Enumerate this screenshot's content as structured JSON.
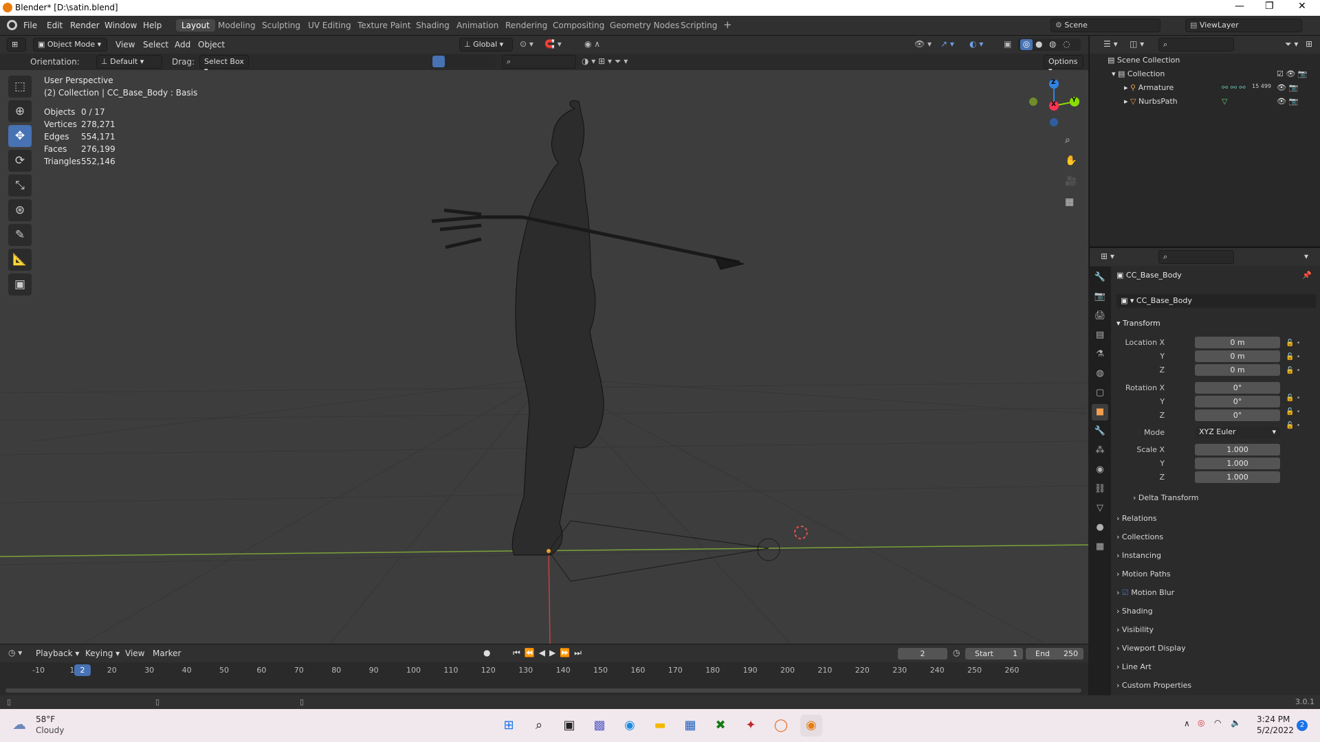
{
  "window": {
    "title": "Blender* [D:\\satin.blend]",
    "controls": [
      "—",
      "❐",
      "✕"
    ]
  },
  "menus": [
    "File",
    "Edit",
    "Render",
    "Window",
    "Help"
  ],
  "workspaces": [
    "Layout",
    "Modeling",
    "Sculpting",
    "UV Editing",
    "Texture Paint",
    "Shading",
    "Animation",
    "Rendering",
    "Compositing",
    "Geometry Nodes",
    "Scripting"
  ],
  "active_workspace": "Layout",
  "scene": {
    "name": "Scene",
    "view_layer": "ViewLayer"
  },
  "viewport_header": {
    "mode": "Object Mode",
    "view": "View",
    "select": "Select",
    "add": "Add",
    "object": "Object",
    "transform_orientation": "Global",
    "options": "Options"
  },
  "tool_settings": {
    "orientation_label": "Orientation:",
    "orientation_value": "Default",
    "drag_label": "Drag:",
    "drag_value": "Select Box"
  },
  "overlay_info": {
    "view_name": "User Perspective",
    "context": "(2) Collection | CC_Base_Body : Basis",
    "stats": [
      {
        "label": "Objects",
        "value": "0 / 17"
      },
      {
        "label": "Vertices",
        "value": "278,271"
      },
      {
        "label": "Edges",
        "value": "554,171"
      },
      {
        "label": "Faces",
        "value": "276,199"
      },
      {
        "label": "Triangles",
        "value": "552,146"
      }
    ]
  },
  "gizmo": {
    "z": "Z",
    "x": "X",
    "y": "Y"
  },
  "outliner": {
    "root": "Scene Collection",
    "collection": "Collection",
    "items": [
      {
        "name": "Armature"
      },
      {
        "name": "NurbsPath"
      }
    ],
    "badge": "15 499"
  },
  "properties": {
    "object_name": "CC_Base_Body",
    "data_name": "CC_Base_Body",
    "transform_title": "Transform",
    "location": {
      "label_x": "Location X",
      "x": "0 m",
      "y": "0 m",
      "z": "0 m"
    },
    "rotation": {
      "label_x": "Rotation X",
      "x": "0°",
      "y": "0°",
      "z": "0°"
    },
    "mode_label": "Mode",
    "mode_value": "XYZ Euler",
    "scale": {
      "label_x": "Scale X",
      "x": "1.000",
      "y": "1.000",
      "z": "1.000"
    },
    "axis_y": "Y",
    "axis_z": "Z",
    "delta": "Delta Transform",
    "panels": [
      "Relations",
      "Collections",
      "Instancing",
      "Motion Paths",
      "Motion Blur",
      "Shading",
      "Visibility",
      "Viewport Display",
      "Line Art",
      "Custom Properties"
    ]
  },
  "timeline": {
    "menus": [
      "Playback",
      "Keying",
      "View",
      "Marker"
    ],
    "current_frame": "2",
    "start_label": "Start",
    "start": "1",
    "end_label": "End",
    "end": "250",
    "ticks": [
      "-10",
      "10",
      "20",
      "30",
      "40",
      "50",
      "60",
      "70",
      "80",
      "90",
      "100",
      "110",
      "120",
      "130",
      "140",
      "150",
      "160",
      "170",
      "180",
      "190",
      "200",
      "210",
      "220",
      "230",
      "240",
      "250",
      "260"
    ]
  },
  "statusbar": {
    "version": "3.0.1"
  },
  "taskbar": {
    "weather_temp": "58°F",
    "weather_desc": "Cloudy",
    "time": "3:24 PM",
    "date": "5/2/2022",
    "notif": "2"
  },
  "colors": {
    "accent": "#4772b3",
    "x_axis": "#ff3352",
    "y_axis": "#8bdc00",
    "z_axis": "#2f83e3",
    "bg": "#3d3d3d"
  }
}
